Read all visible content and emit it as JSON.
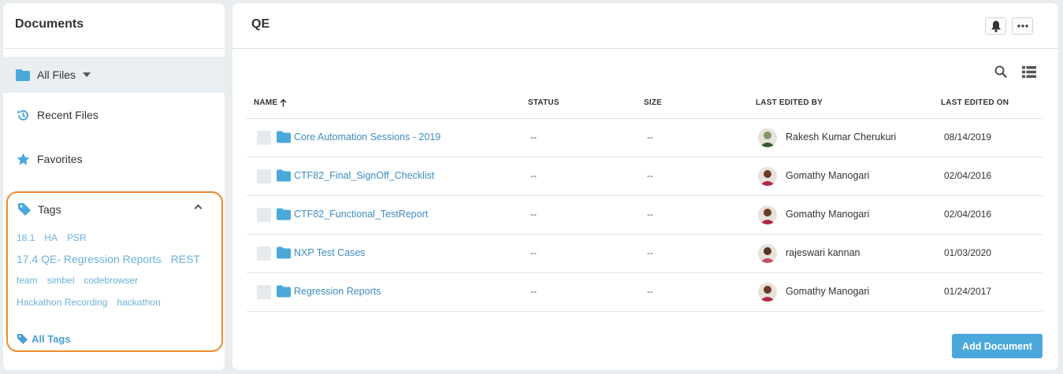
{
  "sidebar": {
    "title": "Documents",
    "all_files": "All Files",
    "recent_files": "Recent Files",
    "favorites": "Favorites",
    "tags_title": "Tags",
    "tags_row1": [
      "18.1",
      "HA",
      "PSR"
    ],
    "tags_row2": [
      "17.4 QE- Regression Reports",
      "REST"
    ],
    "tags_row3": [
      "team",
      "simbel",
      "codebrowser"
    ],
    "tags_row4": [
      "Hackathon Recording",
      "hackathon"
    ],
    "all_tags": "All Tags"
  },
  "main": {
    "title": "QE",
    "columns": {
      "name": "NAME",
      "status": "STATUS",
      "size": "SIZE",
      "last_edited_by": "LAST EDITED BY",
      "last_edited_on": "LAST EDITED ON"
    },
    "rows": [
      {
        "name": "Core Automation Sessions - 2019",
        "status": "--",
        "size": "--",
        "editor": "Rakesh Kumar Cherukuri",
        "date": "08/14/2019"
      },
      {
        "name": "CTF82_Final_SignOff_Checklist",
        "status": "--",
        "size": "--",
        "editor": "Gomathy Manogari",
        "date": "02/04/2016"
      },
      {
        "name": "CTF82_Functional_TestReport",
        "status": "--",
        "size": "--",
        "editor": "Gomathy Manogari",
        "date": "02/04/2016"
      },
      {
        "name": "NXP Test Cases",
        "status": "--",
        "size": "--",
        "editor": "rajeswari kannan",
        "date": "01/03/2020"
      },
      {
        "name": "Regression Reports",
        "status": "--",
        "size": "--",
        "editor": "Gomathy Manogari",
        "date": "01/24/2017"
      }
    ],
    "add_document": "Add Document"
  },
  "colors": {
    "accent": "#4aa8db",
    "link": "#3e8cc1",
    "tag": "#6ab2d9",
    "highlight_border": "#f08a2c"
  }
}
